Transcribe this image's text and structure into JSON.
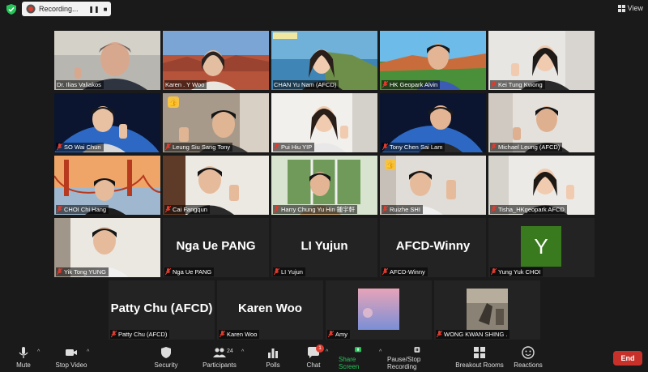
{
  "recording": {
    "label": "Recording...",
    "pause": "❚❚",
    "stop": "■"
  },
  "view_label": "View",
  "participants": [
    {
      "name": "Dr. Ilias Valiakos",
      "muted": false
    },
    {
      "name": "Karen . Y Woo",
      "muted": false
    },
    {
      "name": "CHAN Yu Nam (AFCD)",
      "muted": false
    },
    {
      "name": "HK Geopark Alvin",
      "muted": true
    },
    {
      "name": "Kei Tung Kwong",
      "muted": true
    },
    {
      "name": "SO Wai Chun",
      "muted": true
    },
    {
      "name": "Leung Siu Sang Tony",
      "muted": true
    },
    {
      "name": "Pui Hiu YIP",
      "muted": true
    },
    {
      "name": "Tony Chen Sai Lam",
      "muted": true
    },
    {
      "name": "Michael Leung (AFCD)",
      "muted": true
    },
    {
      "name": "CHOI Chi Hang",
      "muted": true
    },
    {
      "name": "Cai Fangqun",
      "muted": true
    },
    {
      "name": "Harry Chung Yu Hin 鍾宇軒",
      "muted": true
    },
    {
      "name": "Ruizhe SHI",
      "muted": true
    },
    {
      "name": "Tisha_HKgeopark AFCD",
      "muted": true
    },
    {
      "name": "Yik Tong YUNG",
      "muted": true
    },
    {
      "name": "Nga Ue PANG",
      "muted": true,
      "big": "Nga Ue PANG"
    },
    {
      "name": "LI Yujun",
      "muted": true,
      "big": "LI Yujun"
    },
    {
      "name": "AFCD-Winny",
      "muted": true,
      "big": "AFCD-Winny"
    },
    {
      "name": "Yung Yuk CHOI",
      "muted": true,
      "avatar": "Y"
    },
    {
      "name": "Patty Chu (AFCD)",
      "muted": true,
      "big": "Patty Chu (AFCD)"
    },
    {
      "name": "Karen Woo",
      "muted": true,
      "big": "Karen Woo"
    },
    {
      "name": "Amy",
      "muted": true
    },
    {
      "name": "WONG KWAN SHING .",
      "muted": true
    }
  ],
  "reactions": {
    "thumbs_badge": "👍"
  },
  "toolbar": {
    "mute": "Mute",
    "stop_video": "Stop Video",
    "security": "Security",
    "participants": "Participants",
    "participants_count": "24",
    "polls": "Polls",
    "chat": "Chat",
    "chat_badge": "1",
    "share_screen": "Share Screen",
    "recording": "Pause/Stop Recording",
    "breakout": "Breakout Rooms",
    "reactions": "Reactions",
    "end": "End"
  },
  "colors": {
    "active_border": "#b7d96b",
    "share_green": "#27c45a",
    "end_red": "#c8312a",
    "avatar_green": "#3a7a1f"
  }
}
